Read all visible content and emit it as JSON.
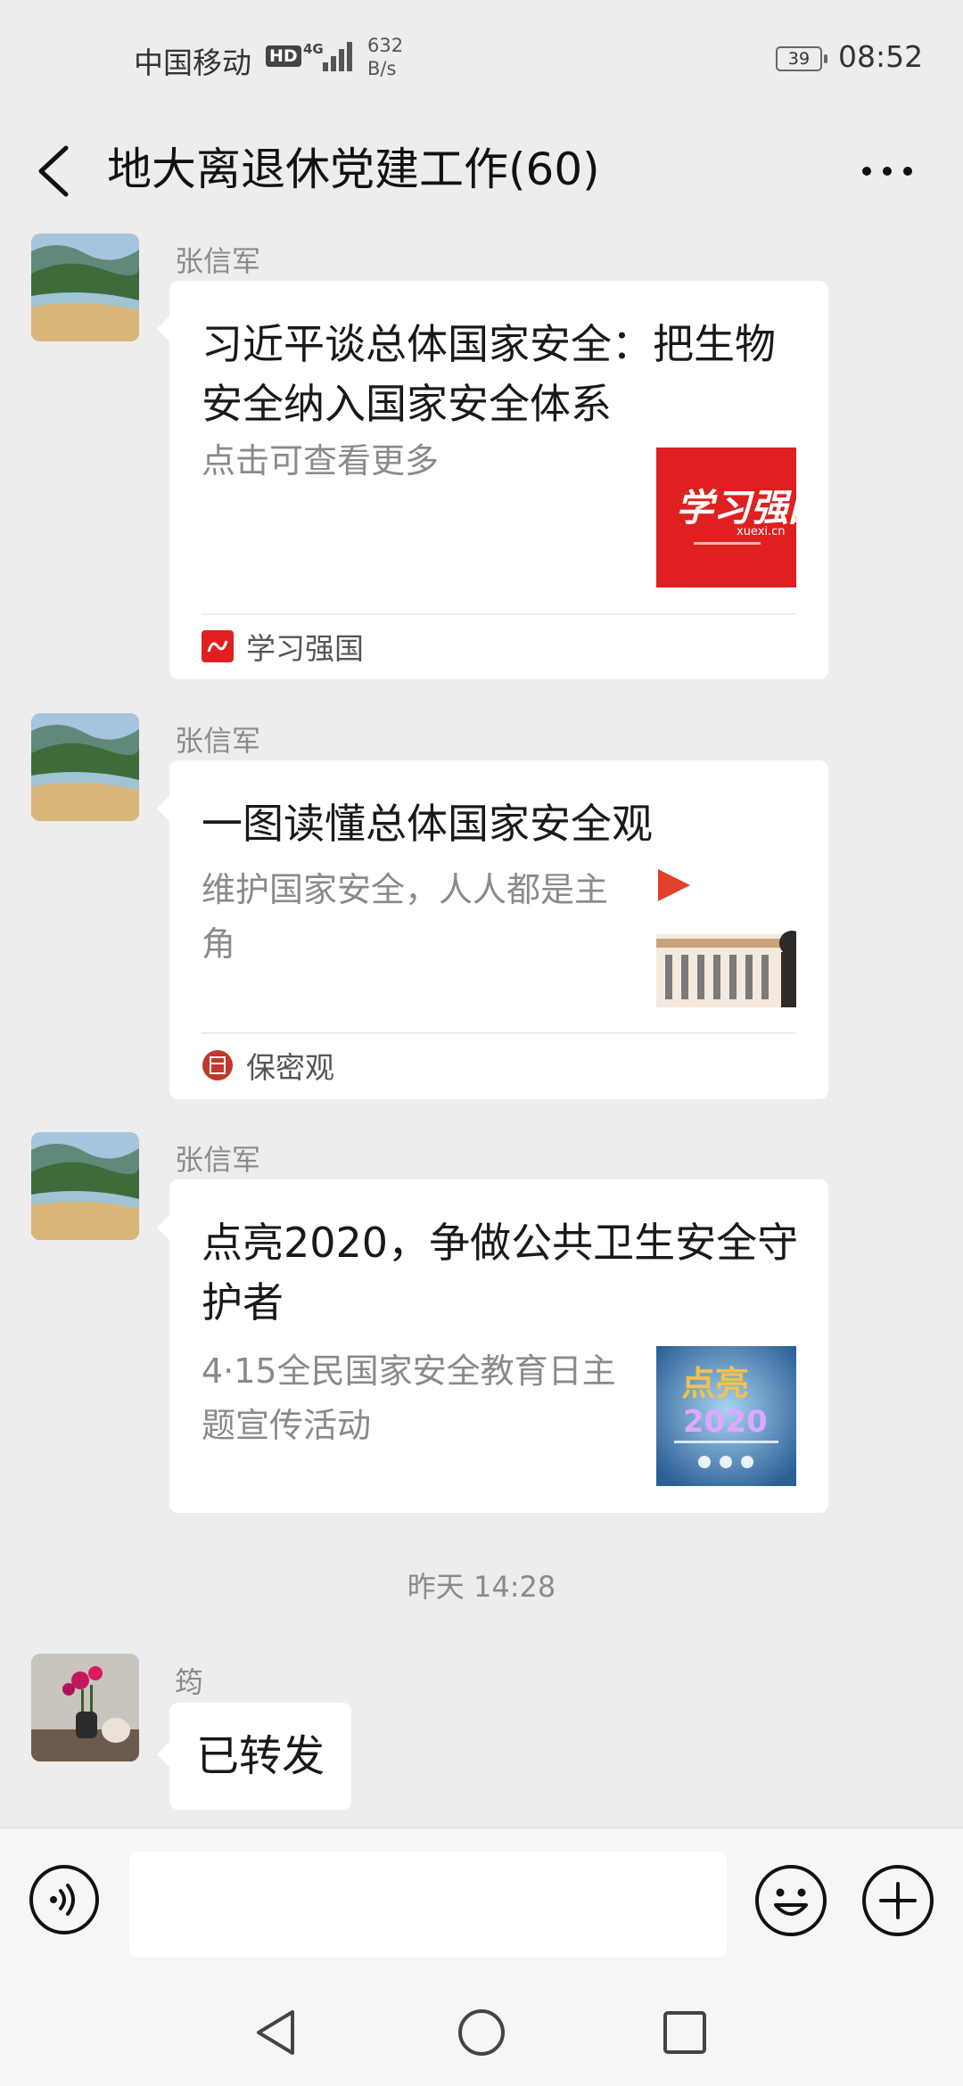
{
  "status_bar": {
    "carrier": "中国移动",
    "hd": "HD",
    "network": "4G",
    "speed_value": "632",
    "speed_unit": "B/s",
    "battery": "39",
    "time": "08:52"
  },
  "header": {
    "title": "地大离退休党建工作(60)",
    "back_icon": "chevron-left-icon",
    "more_icon": "more-dots-icon"
  },
  "messages": [
    {
      "sender": "张信军",
      "type": "link_card",
      "title": "习近平谈总体国家安全：把生物安全纳入国家安全体系",
      "description": "点击可查看更多",
      "thumb_text": "学习强国",
      "thumb_sub": "xuexi.cn",
      "source": "学习强国"
    },
    {
      "sender": "张信军",
      "type": "link_card",
      "title": "一图读懂总体国家安全观",
      "description": "维护国家安全，人人都是主角",
      "source": "保密观"
    },
    {
      "sender": "张信军",
      "type": "link_card",
      "title": "点亮2020，争做公共卫生安全守护者",
      "description": "4·15全民国家安全教育日主题宣传活动",
      "thumb_text": "点亮",
      "thumb_sub": "2020",
      "source": ""
    }
  ],
  "time_separator": "昨天 14:28",
  "text_message": {
    "sender": "筠",
    "text": "已转发"
  },
  "input_bar": {
    "placeholder": "",
    "value": "",
    "voice_icon": "voice-icon",
    "emoji_icon": "emoji-icon",
    "plus_icon": "plus-icon"
  },
  "nav_bar": {
    "back_icon": "triangle-back-icon",
    "home_icon": "circle-home-icon",
    "recent_icon": "square-recent-icon"
  },
  "colors": {
    "background": "#ededed",
    "card": "#ffffff",
    "xuexi_red": "#e02020"
  }
}
